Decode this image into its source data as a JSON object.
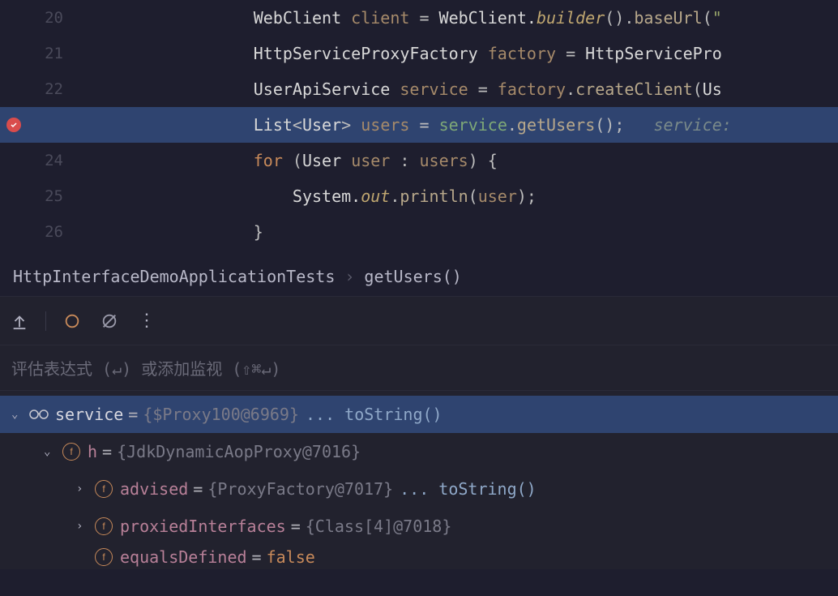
{
  "code": {
    "lines": [
      {
        "num": "20",
        "indent": "                  ",
        "segments": [
          {
            "t": "WebClient ",
            "c": "c-type"
          },
          {
            "t": "client",
            "c": "c-var"
          },
          {
            "t": " = ",
            "c": "c-op"
          },
          {
            "t": "WebClient.",
            "c": "c-type"
          },
          {
            "t": "builder",
            "c": "c-italic"
          },
          {
            "t": "().",
            "c": "c-punc"
          },
          {
            "t": "baseUrl",
            "c": "c-call"
          },
          {
            "t": "(",
            "c": "c-paren"
          },
          {
            "t": "\"",
            "c": "c-str"
          }
        ]
      },
      {
        "num": "21",
        "indent": "                  ",
        "segments": [
          {
            "t": "HttpServiceProxyFactory ",
            "c": "c-type"
          },
          {
            "t": "factory",
            "c": "c-var"
          },
          {
            "t": " = ",
            "c": "c-op"
          },
          {
            "t": "HttpServicePro",
            "c": "c-type"
          }
        ]
      },
      {
        "num": "22",
        "indent": "                  ",
        "segments": [
          {
            "t": "UserApiService ",
            "c": "c-type"
          },
          {
            "t": "service",
            "c": "c-var"
          },
          {
            "t": " = ",
            "c": "c-op"
          },
          {
            "t": "factory",
            "c": "c-var"
          },
          {
            "t": ".",
            "c": "c-punc"
          },
          {
            "t": "createClient",
            "c": "c-call"
          },
          {
            "t": "(",
            "c": "c-paren"
          },
          {
            "t": "Us",
            "c": "c-type"
          }
        ]
      },
      {
        "num": "",
        "highlight": true,
        "breakpoint": true,
        "indent": "                  ",
        "segments": [
          {
            "t": "List",
            "c": "c-type"
          },
          {
            "t": "<",
            "c": "c-punc"
          },
          {
            "t": "User",
            "c": "c-type"
          },
          {
            "t": "> ",
            "c": "c-punc"
          },
          {
            "t": "users",
            "c": "c-var"
          },
          {
            "t": " = ",
            "c": "c-op"
          },
          {
            "t": "service",
            "c": "c-local"
          },
          {
            "t": ".",
            "c": "c-punc"
          },
          {
            "t": "getUsers",
            "c": "c-call"
          },
          {
            "t": "();   ",
            "c": "c-punc"
          },
          {
            "t": "service:",
            "c": "c-hint"
          }
        ]
      },
      {
        "num": "24",
        "indent": "                  ",
        "segments": [
          {
            "t": "for ",
            "c": "c-kw"
          },
          {
            "t": "(",
            "c": "c-paren"
          },
          {
            "t": "User ",
            "c": "c-type"
          },
          {
            "t": "user",
            "c": "c-var"
          },
          {
            "t": " : ",
            "c": "c-op"
          },
          {
            "t": "users",
            "c": "c-var"
          },
          {
            "t": ") {",
            "c": "c-punc"
          }
        ]
      },
      {
        "num": "25",
        "indent": "                      ",
        "segments": [
          {
            "t": "System.",
            "c": "c-type"
          },
          {
            "t": "out",
            "c": "c-italic"
          },
          {
            "t": ".",
            "c": "c-punc"
          },
          {
            "t": "println",
            "c": "c-call"
          },
          {
            "t": "(",
            "c": "c-paren"
          },
          {
            "t": "user",
            "c": "c-var"
          },
          {
            "t": ");",
            "c": "c-punc"
          }
        ]
      },
      {
        "num": "26",
        "indent": "                  ",
        "segments": [
          {
            "t": "}",
            "c": "c-punc"
          }
        ]
      }
    ]
  },
  "breadcrumb": {
    "class": "HttpInterfaceDemoApplicationTests",
    "method": "getUsers()"
  },
  "watch": {
    "placeholder": "评估表达式 (↵) 或添加监视 (⇧⌘↵)"
  },
  "variables": [
    {
      "level": 0,
      "expanded": true,
      "icon": "glasses",
      "selected": true,
      "name": "service",
      "nameClass": "v-name",
      "value": "{$Proxy100@6969} ",
      "navigate": "... toString()"
    },
    {
      "level": 1,
      "expanded": true,
      "icon": "field",
      "name": "h",
      "nameClass": "v-name-field",
      "value": "{JdkDynamicAopProxy@7016}"
    },
    {
      "level": 2,
      "expanded": false,
      "icon": "field",
      "name": "advised",
      "nameClass": "v-name-field",
      "value": "{ProxyFactory@7017} ",
      "navigate": "... toString()"
    },
    {
      "level": 2,
      "expanded": false,
      "icon": "field",
      "name": "proxiedInterfaces",
      "nameClass": "v-name-field",
      "value": "{Class[4]@7018}"
    },
    {
      "level": 2,
      "expanded": null,
      "icon": "field",
      "partial": true,
      "name": "equalsDefined",
      "nameClass": "v-name-field",
      "value": "false",
      "valueClass": "v-bool"
    }
  ]
}
